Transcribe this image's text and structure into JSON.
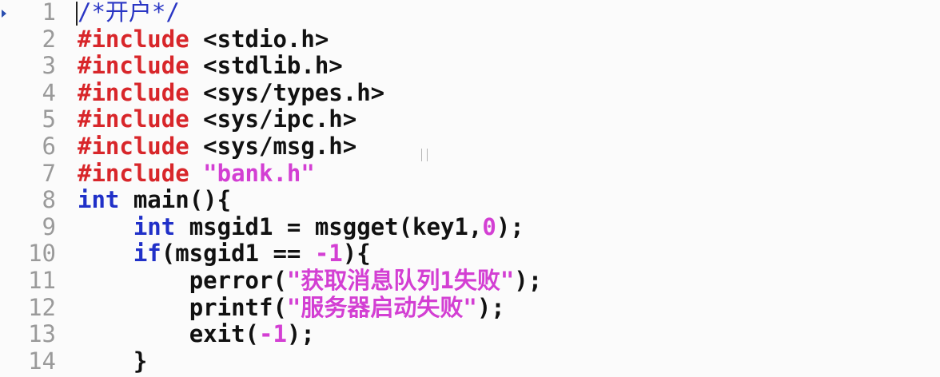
{
  "colors": {
    "preprocessor": "#d8262a",
    "keyword": "#2030c8",
    "string": "#d33fd3",
    "comment": "#2a36c4",
    "line_number": "#9a9a9a",
    "text": "#111111"
  },
  "lines": [
    {
      "num": "1",
      "indent": "",
      "parts": [
        {
          "t": "/*开户*/",
          "c": "com"
        }
      ]
    },
    {
      "num": "2",
      "indent": "",
      "parts": [
        {
          "t": "#include",
          "c": "kw-pre"
        },
        {
          "t": " <stdio.h>",
          "c": ""
        }
      ]
    },
    {
      "num": "3",
      "indent": "",
      "parts": [
        {
          "t": "#include",
          "c": "kw-pre"
        },
        {
          "t": " <stdlib.h>",
          "c": ""
        }
      ]
    },
    {
      "num": "4",
      "indent": "",
      "parts": [
        {
          "t": "#include",
          "c": "kw-pre"
        },
        {
          "t": " <sys/types.h>",
          "c": ""
        }
      ]
    },
    {
      "num": "5",
      "indent": "",
      "parts": [
        {
          "t": "#include",
          "c": "kw-pre"
        },
        {
          "t": " <sys/ipc.h>",
          "c": ""
        }
      ]
    },
    {
      "num": "6",
      "indent": "",
      "parts": [
        {
          "t": "#include",
          "c": "kw-pre"
        },
        {
          "t": " <sys/msg.h>",
          "c": ""
        }
      ]
    },
    {
      "num": "7",
      "indent": "",
      "parts": [
        {
          "t": "#include",
          "c": "kw-pre"
        },
        {
          "t": " ",
          "c": ""
        },
        {
          "t": "\"bank.h\"",
          "c": "str"
        }
      ]
    },
    {
      "num": "8",
      "indent": "",
      "parts": [
        {
          "t": "int",
          "c": "kw"
        },
        {
          "t": " main(){",
          "c": ""
        }
      ]
    },
    {
      "num": "9",
      "indent": "    ",
      "parts": [
        {
          "t": "int",
          "c": "kw"
        },
        {
          "t": " msgid1 = msgget(key1,",
          "c": ""
        },
        {
          "t": "0",
          "c": "num"
        },
        {
          "t": ");",
          "c": ""
        }
      ]
    },
    {
      "num": "10",
      "indent": "    ",
      "parts": [
        {
          "t": "if",
          "c": "kw"
        },
        {
          "t": "(msgid1 == ",
          "c": ""
        },
        {
          "t": "-1",
          "c": "num"
        },
        {
          "t": "){",
          "c": ""
        }
      ]
    },
    {
      "num": "11",
      "indent": "        ",
      "parts": [
        {
          "t": "perror(",
          "c": ""
        },
        {
          "t": "\"获取消息队列1失败\"",
          "c": "str"
        },
        {
          "t": ");",
          "c": ""
        }
      ]
    },
    {
      "num": "12",
      "indent": "        ",
      "parts": [
        {
          "t": "printf(",
          "c": ""
        },
        {
          "t": "\"服务器启动失败\"",
          "c": "str"
        },
        {
          "t": ");",
          "c": ""
        }
      ]
    },
    {
      "num": "13",
      "indent": "        ",
      "parts": [
        {
          "t": "exit(",
          "c": ""
        },
        {
          "t": "-1",
          "c": "num"
        },
        {
          "t": ");",
          "c": ""
        }
      ]
    },
    {
      "num": "14",
      "indent": "    ",
      "parts": [
        {
          "t": "}",
          "c": ""
        }
      ]
    }
  ]
}
